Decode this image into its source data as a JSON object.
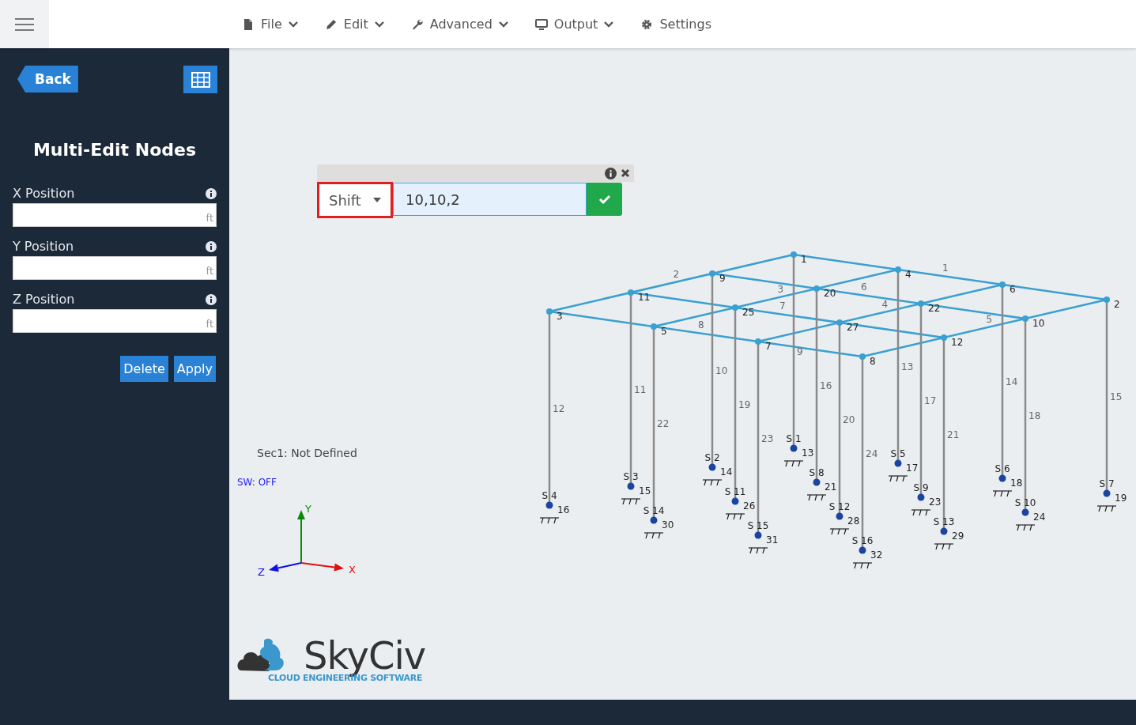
{
  "topbar": {
    "menu": [
      {
        "label": "File",
        "dropdown": true
      },
      {
        "label": "Edit",
        "dropdown": true
      },
      {
        "label": "Advanced",
        "dropdown": true
      },
      {
        "label": "Output",
        "dropdown": true
      },
      {
        "label": "Settings",
        "dropdown": false
      }
    ]
  },
  "sidebar": {
    "back": "Back",
    "title": "Multi-Edit Nodes",
    "fields": [
      {
        "label": "X Position",
        "unit": "ft"
      },
      {
        "label": "Y Position",
        "unit": "ft"
      },
      {
        "label": "Z Position",
        "unit": "ft"
      }
    ],
    "buttons": [
      "Delete",
      "Apply"
    ]
  },
  "popup": {
    "mode": "Shift",
    "value": "10,10,2"
  },
  "canvas": {
    "section_note": "Sec1: Not Defined",
    "self_weight": "SW: OFF",
    "axes": {
      "x": "X",
      "y": "Y",
      "z": "Z"
    },
    "structure": {
      "top_nodes": [
        {
          "label": "1"
        },
        {
          "label": "4"
        },
        {
          "label": "6"
        },
        {
          "label": "2"
        },
        {
          "label": "9"
        },
        {
          "label": "20"
        },
        {
          "label": "22"
        },
        {
          "label": "10"
        },
        {
          "label": "11"
        },
        {
          "label": "25"
        },
        {
          "label": "27"
        },
        {
          "label": "12"
        },
        {
          "label": "3"
        },
        {
          "label": "5"
        },
        {
          "label": "7"
        },
        {
          "label": "8"
        }
      ],
      "beams_x": [
        {
          "label": "1"
        },
        {
          "label": "6"
        },
        {
          "label": "7"
        },
        {
          "label": "8"
        }
      ],
      "beams_z": [
        {
          "label": "2"
        },
        {
          "label": "3"
        },
        {
          "label": "4"
        },
        {
          "label": "5"
        }
      ],
      "columns": [
        {
          "label": "9",
          "support": "S 1",
          "base_node": "13"
        },
        {
          "label": "13",
          "support": "S 5",
          "base_node": "17"
        },
        {
          "label": "14",
          "support": "S 6",
          "base_node": "18"
        },
        {
          "label": "15",
          "support": "S 7",
          "base_node": "19"
        },
        {
          "label": "10",
          "support": "S 2",
          "base_node": "14"
        },
        {
          "label": "16",
          "support": "S 8",
          "base_node": "21"
        },
        {
          "label": "17",
          "support": "S 9",
          "base_node": "23"
        },
        {
          "label": "18",
          "support": "S 10",
          "base_node": "24"
        },
        {
          "label": "11",
          "support": "S 3",
          "base_node": "15"
        },
        {
          "label": "19",
          "support": "S 11",
          "base_node": "26"
        },
        {
          "label": "20",
          "support": "S 12",
          "base_node": "28"
        },
        {
          "label": "21",
          "support": "S 13",
          "base_node": "29"
        },
        {
          "label": "12",
          "support": "S 4",
          "base_node": "16"
        },
        {
          "label": "22",
          "support": "S 14",
          "base_node": "30"
        },
        {
          "label": "23",
          "support": "S 15",
          "base_node": "31"
        },
        {
          "label": "24",
          "support": "S 16",
          "base_node": "32"
        }
      ]
    },
    "logo": {
      "name": "SkyCiv",
      "tagline": "CLOUD ENGINEERING SOFTWARE"
    }
  }
}
